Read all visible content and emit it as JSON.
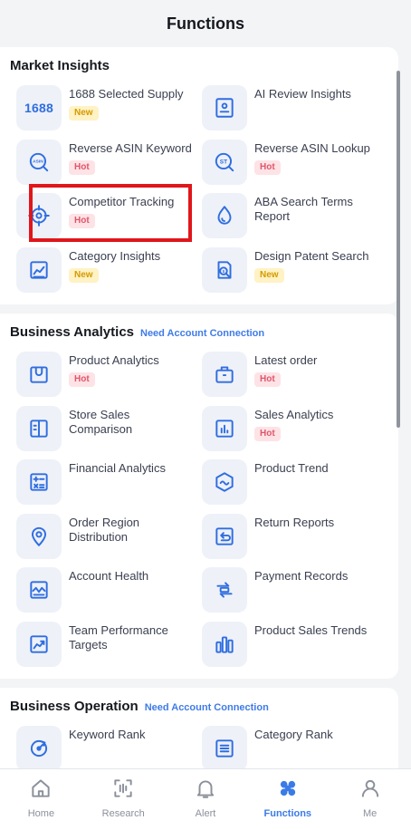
{
  "header": {
    "title": "Functions"
  },
  "sections": [
    {
      "title": "Market Insights",
      "note": "",
      "items": [
        {
          "label": "1688 Selected Supply",
          "badge": "New",
          "icon": "1688-logo-icon",
          "icon_text": "1688"
        },
        {
          "label": "AI Review Insights",
          "badge": "",
          "icon": "review-card-icon"
        },
        {
          "label": "Reverse ASIN Keyword",
          "badge": "Hot",
          "icon": "asin-search-icon",
          "icon_text": "ASIN"
        },
        {
          "label": "Reverse ASIN Lookup",
          "badge": "Hot",
          "icon": "st-search-icon",
          "icon_text": "ST"
        },
        {
          "label": "Competitor Tracking",
          "badge": "Hot",
          "icon": "target-icon"
        },
        {
          "label": "ABA Search Terms Report",
          "badge": "",
          "icon": "drop-icon"
        },
        {
          "label": "Category Insights",
          "badge": "New",
          "icon": "chart-card-icon"
        },
        {
          "label": "Design Patent Search",
          "badge": "New",
          "icon": "patent-search-icon"
        }
      ]
    },
    {
      "title": "Business Analytics",
      "note": "Need Account Connection",
      "items": [
        {
          "label": "Product Analytics",
          "badge": "Hot",
          "icon": "bag-icon"
        },
        {
          "label": "Latest order",
          "badge": "Hot",
          "icon": "order-box-icon"
        },
        {
          "label": "Store Sales Comparison",
          "badge": "",
          "icon": "split-panel-icon"
        },
        {
          "label": "Sales Analytics",
          "badge": "Hot",
          "icon": "bar-chart-icon"
        },
        {
          "label": "Financial Analytics",
          "badge": "",
          "icon": "calculator-icon"
        },
        {
          "label": "Product Trend",
          "badge": "",
          "icon": "hexagon-wave-icon"
        },
        {
          "label": "Order Region Distribution",
          "badge": "",
          "icon": "location-pin-icon"
        },
        {
          "label": "Return Reports",
          "badge": "",
          "icon": "return-arrow-icon"
        },
        {
          "label": "Account Health",
          "badge": "",
          "icon": "health-wave-icon"
        },
        {
          "label": "Payment Records",
          "badge": "",
          "icon": "payment-flow-icon"
        },
        {
          "label": "Team Performance Targets",
          "badge": "",
          "icon": "trend-up-icon"
        },
        {
          "label": "Product Sales Trends",
          "badge": "",
          "icon": "column-bars-icon"
        }
      ]
    },
    {
      "title": "Business Operation",
      "note": "Need Account Connection",
      "items": [
        {
          "label": "Keyword Rank",
          "badge": "",
          "icon": "rank-dial-icon"
        },
        {
          "label": "Category Rank",
          "badge": "",
          "icon": "list-rank-icon"
        }
      ]
    }
  ],
  "tabs": [
    {
      "label": "Home",
      "icon": "home-icon",
      "active": false
    },
    {
      "label": "Research",
      "icon": "research-icon",
      "active": false
    },
    {
      "label": "Alert",
      "icon": "bell-icon",
      "active": false
    },
    {
      "label": "Functions",
      "icon": "functions-grid-icon",
      "active": true
    },
    {
      "label": "Me",
      "icon": "person-icon",
      "active": false
    }
  ],
  "colors": {
    "accent": "#3b7be8",
    "icon_stroke": "#2f6ee0",
    "badge_new_bg": "#fff2c4",
    "badge_new_text": "#d49a00",
    "badge_hot_bg": "#fde3e6",
    "badge_hot_text": "#e0566a",
    "highlight": "#e0161b"
  }
}
